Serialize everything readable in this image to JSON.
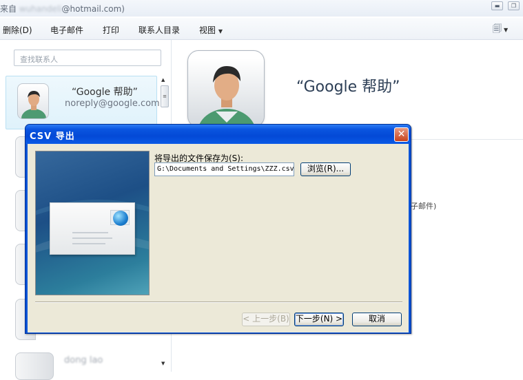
{
  "window": {
    "title_prefix": "来自",
    "title_blurred": "wuhandeli",
    "title_suffix": "@hotmail.com)"
  },
  "menu": {
    "delete": "删除(D)",
    "email": "电子邮件",
    "print": "打印",
    "directory": "联系人目录",
    "view": "视图"
  },
  "sidebar": {
    "search_placeholder": "查找联系人",
    "selected_contact": {
      "name": "“Google 帮助”",
      "email": "noreply@google.com"
    },
    "bottom_contact_name": "dong lao"
  },
  "detail": {
    "name": "“Google 帮助”",
    "fragment": "子邮件)"
  },
  "dialog": {
    "title": "CSV 导出",
    "save_label": "将导出的文件保存为(S):",
    "path_value": "G:\\Documents and Settings\\ZZZ.csv",
    "browse_button": "浏览(R)...",
    "back_button": "< 上一步(B)",
    "next_button": "下一步(N) >",
    "cancel_button": "取消",
    "close_icon": "close-icon"
  },
  "colors": {
    "dialog_title_blue": "#0a55e0",
    "dialog_body": "#ece9d8",
    "close_red": "#c8421c",
    "contact_highlight": "#dff2fb"
  }
}
